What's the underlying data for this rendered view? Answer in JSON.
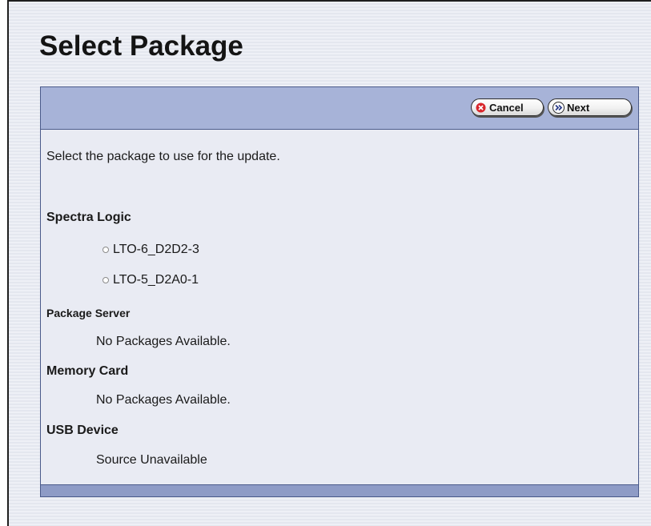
{
  "page": {
    "title": "Select Package"
  },
  "toolbar": {
    "cancel_label": "Cancel",
    "next_label": "Next",
    "cancel_icon": "cancel-icon",
    "next_icon": "double-chevron-right-icon"
  },
  "content": {
    "instruction": "Select the package to use for the update.",
    "sections": [
      {
        "heading": "Spectra Logic",
        "packages": [
          {
            "label": "LTO-6_D2D2-3",
            "selected": false
          },
          {
            "label": "LTO-5_D2A0-1",
            "selected": false
          }
        ]
      },
      {
        "heading": "Package Server",
        "status": "No Packages Available."
      },
      {
        "heading": "Memory Card",
        "status": "No Packages Available."
      },
      {
        "heading": "USB Device",
        "status": "Source Unavailable"
      }
    ]
  },
  "colors": {
    "toolbar_bg": "#a7b3d8",
    "panel_bg": "#e9ebf3",
    "footer_bg": "#8e9bc6",
    "cancel_icon_red": "#d8262b"
  }
}
